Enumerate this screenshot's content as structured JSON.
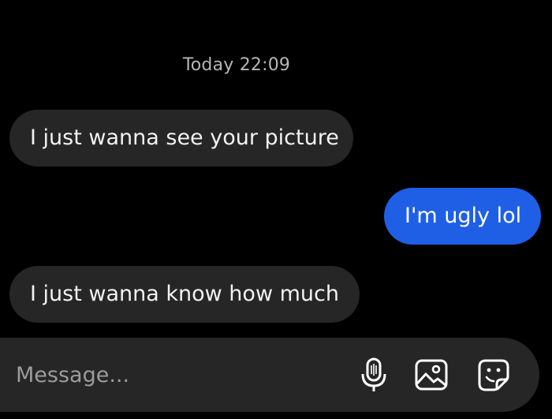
{
  "conversation": {
    "timestamp": "Today 22:09",
    "messages": [
      {
        "direction": "incoming",
        "text": "I just wanna see your picture"
      },
      {
        "direction": "outgoing",
        "text": "I'm ugly lol"
      },
      {
        "direction": "incoming",
        "text": "I just wanna know how much"
      }
    ]
  },
  "composer": {
    "placeholder": "Message...",
    "value": "",
    "icons": [
      "microphone-icon",
      "image-icon",
      "sticker-icon"
    ]
  },
  "colors": {
    "background": "#000000",
    "incoming_bubble": "#262626",
    "outgoing_bubble": "#1e5fe6",
    "timestamp_text": "#b7b7b7",
    "placeholder_text": "#9c9c9c"
  }
}
